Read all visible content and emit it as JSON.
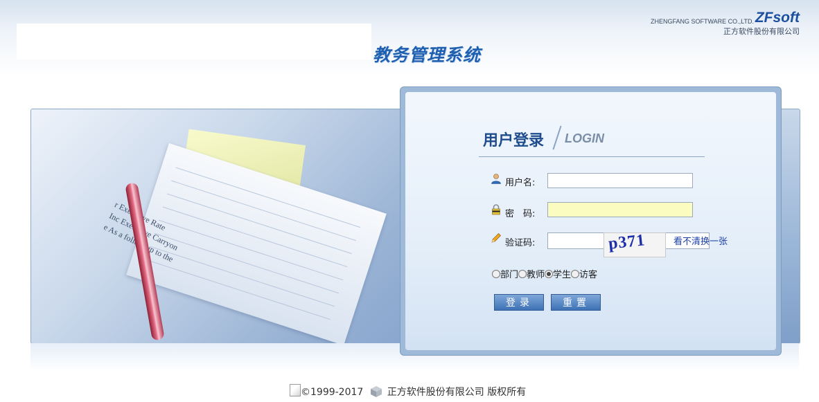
{
  "header": {
    "company_en": "ZHENGFANG SOFTWARE CO.,LTD.",
    "logo": "ZFsoft",
    "company_cn": "正方软件股份有限公司",
    "system_title": "教务管理系统"
  },
  "hero": {
    "doc_lines": [
      "r Executive Rate",
      "Inc Executive Carryon",
      "e  As a follow-up to the"
    ]
  },
  "login": {
    "title_cn": "用户登录",
    "title_en": "LOGIN",
    "username_label": "用户名:",
    "username_value": "",
    "password_label": "密　码:",
    "password_value": "",
    "captcha_label": "验证码:",
    "captcha_value": "",
    "captcha_text": "p371",
    "refresh_link": "看不清换一张",
    "roles": [
      {
        "label": "部门",
        "checked": false
      },
      {
        "label": "教师",
        "checked": false
      },
      {
        "label": "学生",
        "checked": true
      },
      {
        "label": "访客",
        "checked": false
      }
    ],
    "login_button": "登录",
    "reset_button": "重置"
  },
  "footer": {
    "copyright": "©1999-2017",
    "company": "正方软件股份有限公司 版权所有"
  },
  "icons": {
    "user": "user-icon",
    "lock": "lock-icon",
    "pencil": "pencil-icon",
    "broken_image": "broken-image-icon",
    "company_logo": "cube-logo-icon"
  },
  "colors": {
    "title_blue": "#1f5fb0",
    "button_blue": "#3e72b6",
    "password_bg": "#fafcc0"
  }
}
